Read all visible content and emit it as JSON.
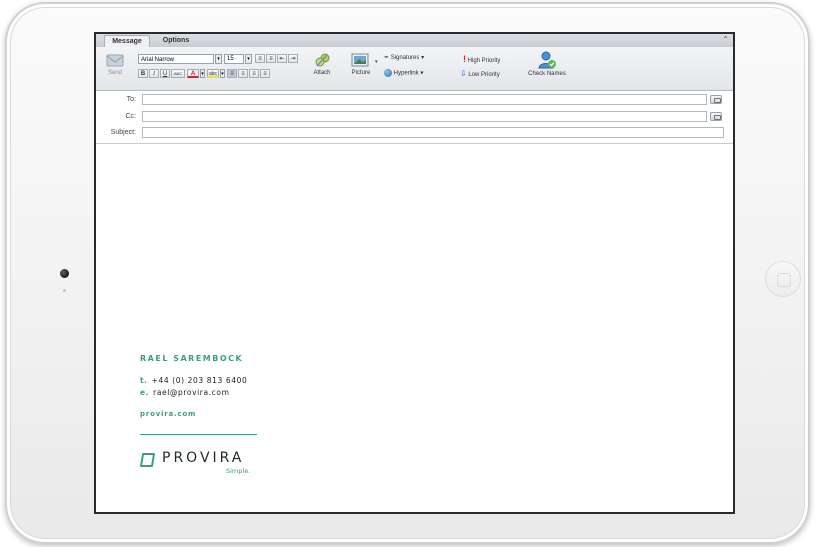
{
  "tabs": [
    {
      "label": "Message",
      "active": true
    },
    {
      "label": "Options",
      "active": false
    }
  ],
  "ribbon": {
    "send_label": "Send",
    "font_name": "Arial Narrow",
    "font_size": "15",
    "bold": "B",
    "italic": "I",
    "underline": "U",
    "abc": "ABC",
    "font_color_glyph": "A",
    "highlight_glyph": "abc",
    "attach_label": "Attach",
    "picture_label": "Picture",
    "signatures_label": "Signatures",
    "hyperlink_label": "Hyperlink",
    "high_priority_label": "High Priority",
    "low_priority_label": "Low Priority",
    "check_names_label": "Check Names"
  },
  "header": {
    "to_label": "To:",
    "cc_label": "Cc:",
    "subject_label": "Subject:",
    "to_value": "",
    "cc_value": "",
    "subject_value": ""
  },
  "signature": {
    "name": "RAEL SAREMBOCK",
    "phone_key": "t.",
    "phone": "+44 (0) 203 813 6400",
    "email_key": "e.",
    "email": "rael@provira.com",
    "website": "provira.com",
    "logo_text": "PROVIRA",
    "tagline": "Simple."
  },
  "colors": {
    "brand_green": "#3e9e7b",
    "high_priority_red": "#d4242a",
    "low_priority_blue": "#2f74c7"
  }
}
